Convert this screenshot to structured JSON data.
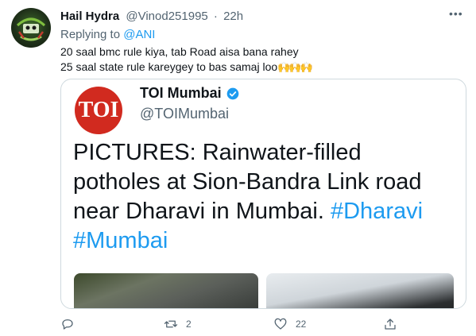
{
  "tweet": {
    "author_name": "Hail Hydra",
    "author_handle": "@Vinod251995",
    "separator": "·",
    "time": "22h",
    "replying_prefix": "Replying to",
    "replying_to": "@ANI",
    "text_line1": "20 saal bmc rule kiya, tab Road aisa bana rahey",
    "text_line2": "25 saal state rule kareygey to bas samaj loo",
    "emoji": "🙌🙌🙌",
    "more_label": "•••"
  },
  "quoted": {
    "logo_text": "TOI",
    "name": "TOI Mumbai",
    "handle": "@TOIMumbai",
    "text_main": "PICTURES: Rainwater-filled potholes at Sion-Bandra Link road near Dharavi in Mumbai.",
    "hashtag1": "#Dharavi",
    "hashtag2": "#Mumbai"
  },
  "actions": {
    "reply_count": "",
    "retweet_count": "2",
    "like_count": "22"
  },
  "colors": {
    "accent": "#1d9bf0",
    "muted": "#536471",
    "toi_red": "#d12a1f"
  },
  "icons": [
    "reply-icon",
    "retweet-icon",
    "like-icon",
    "share-icon",
    "verified-icon",
    "more-icon"
  ]
}
